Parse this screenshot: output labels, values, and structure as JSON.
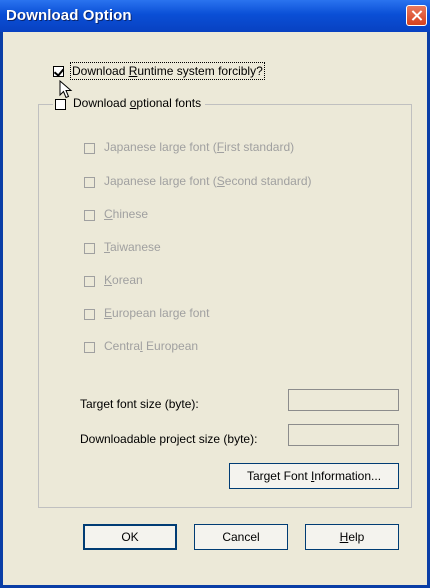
{
  "window": {
    "title": "Download Option"
  },
  "runtime": {
    "label_pre": "Download ",
    "label_key": "R",
    "label_post": "untime system forcibly?",
    "checked": true
  },
  "fonts_group": {
    "label_pre": "Download ",
    "label_key": "o",
    "label_post": "ptional fonts",
    "checked": false,
    "items": [
      {
        "pre": "Japanese large font (",
        "key": "F",
        "post": "irst standard)"
      },
      {
        "pre": "Japanese large font (",
        "key": "S",
        "post": "econd standard)"
      },
      {
        "pre": "",
        "key": "C",
        "post": "hinese"
      },
      {
        "pre": "",
        "key": "T",
        "post": "aiwanese"
      },
      {
        "pre": "",
        "key": "K",
        "post": "orean"
      },
      {
        "pre": "",
        "key": "E",
        "post": "uropean large font"
      },
      {
        "pre": "Centra",
        "key": "l",
        "post": " European"
      }
    ],
    "target_font_size_label": "Target font size (byte):",
    "target_font_size_value": "",
    "project_size_label": "Downloadable project size (byte):",
    "project_size_value": "",
    "info_button": {
      "pre": "Target Font ",
      "key": "I",
      "post": "nformation..."
    }
  },
  "buttons": {
    "ok": "OK",
    "cancel": "Cancel",
    "help_key": "H",
    "help_post": "elp"
  }
}
